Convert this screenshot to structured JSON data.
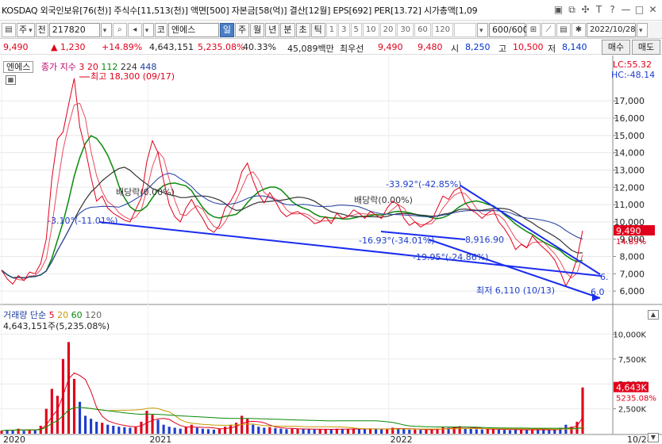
{
  "header": {
    "info": "KOSDAQ 외국인보유[76(천)] 주식수[11,513(천)] 액면[500] 자본금[58(억)] 결산[12월] EPS[692] PER[13.72] 시가총액[1,09",
    "icons": [
      "save-icon",
      "copy-icon",
      "settings-icon",
      "font-icon",
      "help-icon",
      "minimize-icon",
      "maximize-icon",
      "close-icon"
    ],
    "icon_glyphs": [
      "▣",
      "⧉",
      "✣",
      "T",
      "?",
      "—",
      "□",
      "✕"
    ]
  },
  "toolbar": {
    "market_select": "주",
    "type_select": "전",
    "code": "217820",
    "name_prefix": "코",
    "name": "엔에스",
    "periods": [
      "일",
      "주",
      "월",
      "년",
      "분",
      "초",
      "틱"
    ],
    "active_period": "일",
    "intervals": [
      "1",
      "3",
      "5",
      "10",
      "20",
      "30",
      "60",
      "120"
    ],
    "count": "600/600",
    "date": "2022/10/28"
  },
  "pricebar": {
    "price": "9,490",
    "change": "▲ 1,230",
    "change_pct": "+14.89%",
    "volume": "4,643,151",
    "volume_pct": "5,235.08%",
    "turnover_pct": "40.33%",
    "amount": "45,089백만",
    "best_sell_label": "최우선",
    "best_sell": "9,490",
    "best_buy": "9,480",
    "open_label": "시",
    "open": "8,250",
    "high_label": "고",
    "high": "10,500",
    "low_label": "저",
    "low": "8,140",
    "buy_button": "매수",
    "sell_button": "매도"
  },
  "chart_data": {
    "type": "line",
    "stock_label": "엔에스",
    "price_legend": {
      "label": "종가 지수",
      "periods": [
        "3",
        "20",
        "112",
        "224",
        "448"
      ],
      "colors": [
        "#e0001b",
        "#e0001b",
        "#0a8a0a",
        "#333333",
        "#1e3d9e"
      ]
    },
    "volume_legend": {
      "label": "거래량 단순",
      "periods": [
        "5",
        "20",
        "60",
        "120"
      ],
      "colors": [
        "#e0001b",
        "#c49a00",
        "#0a8a0a",
        "#666666"
      ]
    },
    "volume_value": "4,643,151주(5,235.08%)",
    "lc": "LC:55.32",
    "hc": "HC:-48.14",
    "price_ylim": [
      5500,
      18800
    ],
    "price_ticks": [
      6000,
      7000,
      8000,
      9000,
      10000,
      11000,
      12000,
      13000,
      14000,
      15000,
      16000,
      17000
    ],
    "price_tick_labels": [
      "6,000",
      "7,000",
      "8,000",
      "9,000",
      "10,000",
      "11,000",
      "12,000",
      "13,000",
      "14,000",
      "15,000",
      "16,000",
      "17,000"
    ],
    "volume_ylim": [
      0,
      12500
    ],
    "volume_ticks": [
      2500,
      5000,
      7500,
      10000
    ],
    "volume_tick_labels": [
      "2,500K",
      "5,000K",
      "7,500K",
      "10,000K"
    ],
    "x_labels": [
      "2020",
      "2021",
      "2022",
      "10/28"
    ],
    "current_price": "9,490",
    "current_pct": "14.89%",
    "current_volume": "4,643K",
    "current_volume_pct": "5235.08%",
    "closes": [
      7200,
      6700,
      6400,
      6900,
      6600,
      7100,
      7000,
      7600,
      9000,
      12500,
      14800,
      15200,
      16800,
      18300,
      15500,
      14200,
      12600,
      11200,
      11500,
      10800,
      10500,
      10300,
      10100,
      10000,
      10700,
      11400,
      13500,
      14700,
      14000,
      12400,
      11000,
      10300,
      10000,
      10800,
      11300,
      10700,
      10200,
      9600,
      9400,
      9800,
      10800,
      11200,
      11800,
      12900,
      13400,
      12400,
      11600,
      11100,
      11700,
      11200,
      10600,
      10300,
      10500,
      10600,
      10400,
      10200,
      9900,
      10000,
      10300,
      9900,
      10500,
      10200,
      10300,
      10700,
      10500,
      10200,
      10600,
      10400,
      10200,
      10800,
      11200,
      11000,
      10200,
      9800,
      10000,
      9700,
      9900,
      10100,
      10800,
      11500,
      11300,
      11800,
      12000,
      11100,
      10700,
      10500,
      10200,
      10500,
      10700,
      10000,
      9600,
      9100,
      8400,
      8700,
      8500,
      9200,
      8800,
      8500,
      8200,
      7800,
      7100,
      6300,
      6900,
      7900,
      9490
    ],
    "volumes": [
      300,
      400,
      350,
      500,
      300,
      400,
      350,
      800,
      2500,
      4500,
      3800,
      7500,
      9200,
      5500,
      3200,
      1800,
      1500,
      1200,
      1100,
      900,
      800,
      700,
      650,
      600,
      700,
      1200,
      2300,
      1900,
      1400,
      900,
      700,
      600,
      500,
      700,
      900,
      600,
      500,
      450,
      400,
      500,
      700,
      900,
      1100,
      1800,
      1500,
      900,
      700,
      600,
      650,
      550,
      500,
      450,
      500,
      480,
      460,
      440,
      420,
      430,
      460,
      420,
      500,
      460,
      470,
      520,
      480,
      450,
      490,
      470,
      440,
      520,
      600,
      550,
      450,
      400,
      420,
      390,
      410,
      430,
      520,
      650,
      600,
      700,
      750,
      550,
      480,
      450,
      420,
      460,
      480,
      400,
      380,
      350,
      450,
      400,
      380,
      420,
      400,
      380,
      360,
      450,
      600,
      900,
      700,
      1200,
      4643
    ],
    "annotations": {
      "max": "최고 18,300 (09/17)",
      "min": "최저 6,110 (10/13)",
      "dividend_1": "배당락(0.00%)",
      "dividend_2": "배당락(0.00%)",
      "trend_1": "-3.10°(-11.01%)",
      "trend_2": "-16.93°(-34.01%)",
      "trend_3": "-33.92°(-42.85%)",
      "trend_4": "-19.95°(-24.86%)",
      "level": "8,916.90",
      "edge_1": "6.",
      "edge_2": "6.0"
    }
  }
}
